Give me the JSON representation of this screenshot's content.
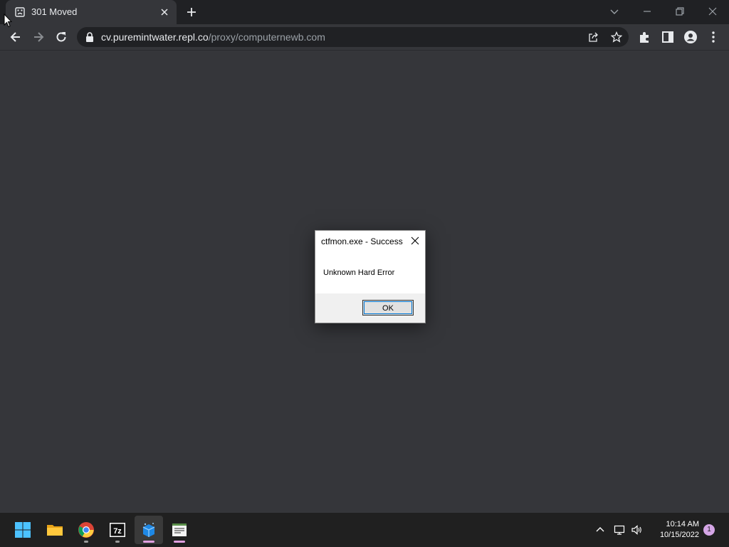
{
  "browser": {
    "tab": {
      "title": "301 Moved"
    },
    "address": {
      "host": "cv.puremintwater.repl.co",
      "path": "/proxy/computernewb.com"
    }
  },
  "dialog": {
    "title": "ctfmon.exe - Success",
    "message": "Unknown Hard Error",
    "ok_label": "OK"
  },
  "taskbar": {
    "apps": [
      "start-icon",
      "file-explorer-icon",
      "chrome-icon",
      "7zip-icon",
      "app-blue-icon",
      "notepad-icon"
    ],
    "time": "10:14 AM",
    "date": "10/15/2022",
    "notification_count": "1"
  },
  "icons": {
    "back": "arrow-left",
    "forward": "arrow-right",
    "reload": "refresh",
    "lock": "lock",
    "share": "share",
    "star": "star",
    "extensions": "puzzle",
    "sidepanel": "side-panel",
    "profile": "person",
    "menu": "kebab"
  },
  "colors": {
    "tabstrip": "#202124",
    "toolbar": "#35363a",
    "taskbar": "#202020",
    "accent": "#0078d7"
  }
}
